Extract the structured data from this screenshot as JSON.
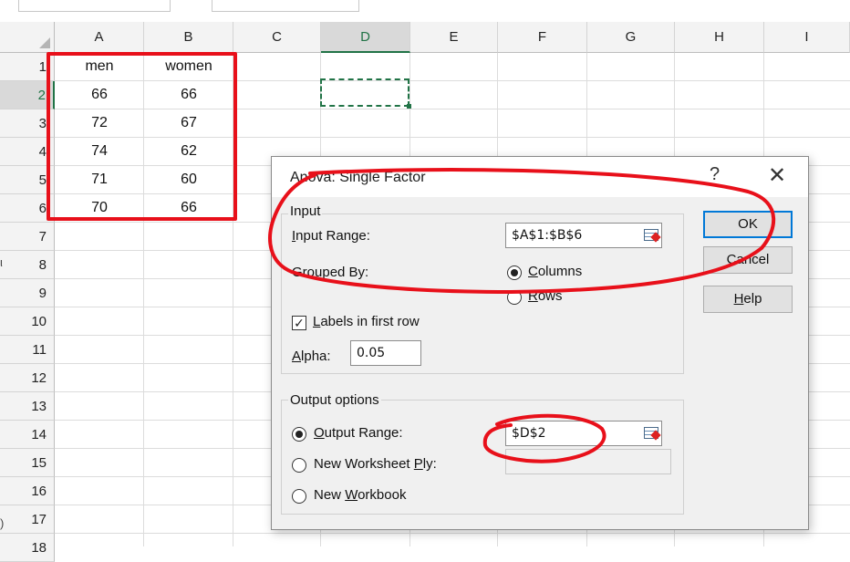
{
  "spreadsheet": {
    "columns": [
      "A",
      "B",
      "C",
      "D",
      "E",
      "F",
      "G",
      "H",
      "I"
    ],
    "selected_column": "D",
    "rows": [
      "1",
      "2",
      "3",
      "4",
      "5",
      "6",
      "7",
      "8",
      "9",
      "10",
      "11",
      "12",
      "13",
      "14",
      "15",
      "16",
      "17",
      "18"
    ],
    "selected_row": "2",
    "cells": [
      {
        "ref": "A1",
        "value": "men"
      },
      {
        "ref": "B1",
        "value": "women"
      },
      {
        "ref": "A2",
        "value": "66"
      },
      {
        "ref": "B2",
        "value": "66"
      },
      {
        "ref": "A3",
        "value": "72"
      },
      {
        "ref": "B3",
        "value": "67"
      },
      {
        "ref": "A4",
        "value": "74"
      },
      {
        "ref": "B4",
        "value": "62"
      },
      {
        "ref": "A5",
        "value": "71"
      },
      {
        "ref": "B5",
        "value": "60"
      },
      {
        "ref": "A6",
        "value": "70"
      },
      {
        "ref": "B6",
        "value": "66"
      }
    ],
    "active_cell": "D2",
    "left_edge_marks": [
      "ι",
      ")"
    ]
  },
  "dialog": {
    "title": "Anova: Single Factor",
    "help_glyph": "?",
    "close_glyph": "✕",
    "input": {
      "group_title": "Input",
      "input_range_label_u": "I",
      "input_range_label_rest": "nput Range:",
      "input_range_value": "$A$1:$B$6",
      "grouped_by_label": "Grouped By:",
      "columns_label_u": "C",
      "columns_label_rest": "olumns",
      "columns_selected": true,
      "rows_label_u": "R",
      "rows_label_rest": "ows",
      "rows_selected": false,
      "labels_first_row_label_u": "L",
      "labels_first_row_label_rest": "abels in first row",
      "labels_first_row_checked": "✓",
      "alpha_label_u": "A",
      "alpha_label_rest": "lpha:",
      "alpha_value": "0.05"
    },
    "output": {
      "group_title": "Output options",
      "output_range_label_u": "O",
      "output_range_label_rest": "utput Range:",
      "output_range_selected": true,
      "output_range_value": "$D$2",
      "new_worksheet_label_pre": "New Worksheet ",
      "new_worksheet_label_u": "P",
      "new_worksheet_label_rest": "ly:",
      "new_worksheet_value": "",
      "new_workbook_label_pre": "New ",
      "new_workbook_label_u": "W",
      "new_workbook_label_rest": "orkbook"
    },
    "buttons": {
      "ok": "OK",
      "cancel": "Cancel",
      "help_u": "H",
      "help_rest": "elp"
    }
  },
  "colors": {
    "annotation_red": "#e8101a",
    "excel_green": "#217346",
    "default_button_blue": "#0078d7"
  }
}
